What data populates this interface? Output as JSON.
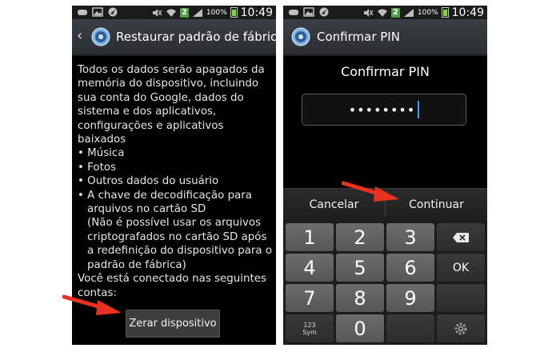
{
  "left": {
    "status": {
      "battery_pct": "100%",
      "time": "10:49",
      "badge": "2"
    },
    "title": "Restaurar padrão de fábrica",
    "body": {
      "intro": "Todos os dados serão apagados da memória do dispositivo, incluindo sua conta do Google, dados do sistema e dos aplicativos, configurações e aplicativos baixados",
      "items": [
        "• Música",
        "• Fotos",
        "• Outros dados do usuário",
        "• A chave de decodificação para arquivos no cartão SD"
      ],
      "note": "(Não é possível usar os arquivos criptografados no cartão SD após a redefinição do dispositivo para o padrão de fábrica)",
      "accounts": "Você está conectado nas seguintes contas:"
    },
    "reset_button": "Zerar dispositivo"
  },
  "right": {
    "status": {
      "battery_pct": "100%",
      "time": "10:49",
      "badge": "2"
    },
    "title": "Confirmar PIN",
    "pin_heading": "Confirmar PIN",
    "pin_value": "••••••••",
    "cancel_label": "Cancelar",
    "continue_label": "Continuar",
    "keys": {
      "k1": "1",
      "k2": "2",
      "k3": "3",
      "k4": "4",
      "k5": "5",
      "k6": "6",
      "k7": "7",
      "k8": "8",
      "k9": "9",
      "k0": "0",
      "ok": "OK",
      "sym_top": "123",
      "sym_bottom": "Sym"
    }
  },
  "colors": {
    "arrow": "#e8321f",
    "cursor": "#3aa0ff",
    "title_bar": "#32373c",
    "key": "#606060"
  }
}
